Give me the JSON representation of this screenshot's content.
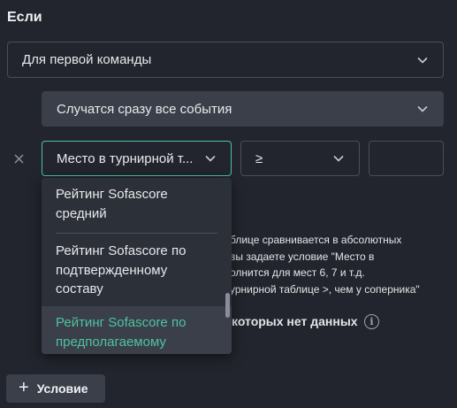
{
  "heading": "Если",
  "team_select": {
    "value": "Для первой команды"
  },
  "events_select": {
    "value": "Случатся сразу все события"
  },
  "condition": {
    "remove_icon": "close-icon",
    "field_select": {
      "value": "Место в турнирной т..."
    },
    "operator_select": {
      "value": "≥"
    },
    "value_input": {
      "value": ""
    }
  },
  "dropdown_options": [
    {
      "label_line1": "Рейтинг Sofascore",
      "label_line2": "средний"
    },
    {
      "label_line1": "Рейтинг Sofascore по",
      "label_line2": "подтвержденному",
      "label_line3": "составу"
    },
    {
      "label_line1": "Рейтинг Sofascore по",
      "label_line2": "предполагаемому"
    }
  ],
  "info_lines": [
    "блице сравнивается в абсолютных",
    "вы задаете условие \"Место в",
    "олнится для мест 6, 7 и т.д.",
    "урнирной таблице >, чем у соперника\""
  ],
  "nodata_label": "которых нет данных",
  "info_icon": "info-icon",
  "add_button": {
    "label": "Условие",
    "icon": "plus-icon"
  },
  "colors": {
    "background": "#22252d",
    "accent": "#4dc3a1",
    "filled_control": "#3b3f49",
    "border": "#4a4e59"
  }
}
